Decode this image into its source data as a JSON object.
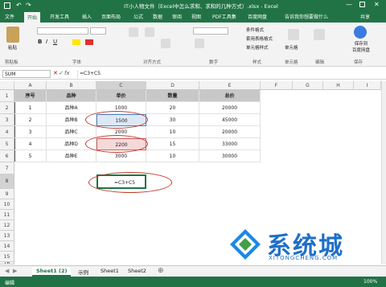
{
  "window": {
    "title": "IT小人物文件（Excel中怎么求和、求和的几种方式）.xlsx - Excel"
  },
  "menu": {
    "tabs": [
      "文件",
      "开始",
      "开发工具",
      "插入",
      "页面布局",
      "公式",
      "数据",
      "审阅",
      "视图",
      "PDF工具集",
      "百度网盘"
    ],
    "tell_me": "告诉我你想要做什么",
    "share": "共享"
  },
  "ribbon": {
    "font_name": "",
    "font_size": "",
    "groups": [
      "剪贴板",
      "字体",
      "对齐方式",
      "数字",
      "样式",
      "单元格",
      "编辑"
    ],
    "paste": "粘贴",
    "styles_items": [
      "条件格式",
      "套用表格格式",
      "单元格样式"
    ],
    "cells_label": "单元格",
    "save_baidu": "保存到\n百度网盘",
    "save_label": "保存"
  },
  "formula_bar": {
    "name_box": "SUM",
    "formula": "=C3+C5"
  },
  "sheet": {
    "columns": [
      "A",
      "B",
      "C",
      "D",
      "E",
      "F",
      "G",
      "H",
      "I"
    ],
    "rows": [
      "1",
      "2",
      "3",
      "4",
      "5",
      "6",
      "7",
      "8",
      "9",
      "10",
      "11",
      "12",
      "13",
      "14",
      "15",
      "16"
    ],
    "headers": [
      "序号",
      "品种",
      "单价",
      "数量",
      "总价"
    ],
    "data": [
      [
        "1",
        "品种A",
        "1000",
        "20",
        "20000"
      ],
      [
        "2",
        "品种B",
        "1500",
        "30",
        "45000"
      ],
      [
        "3",
        "品种C",
        "2000",
        "10",
        "20000"
      ],
      [
        "4",
        "品种D",
        "2200",
        "15",
        "33000"
      ],
      [
        "5",
        "品种E",
        "3000",
        "10",
        "30000"
      ]
    ],
    "editing_cell": "=C3+C5"
  },
  "sheet_tabs": [
    "Sheet1 (2)",
    "示例",
    "Sheet1",
    "Sheet2"
  ],
  "status": {
    "mode": "编辑",
    "zoom": "100%"
  },
  "watermark": {
    "text": "系统城",
    "url": "XITONGCHENG.COM"
  }
}
